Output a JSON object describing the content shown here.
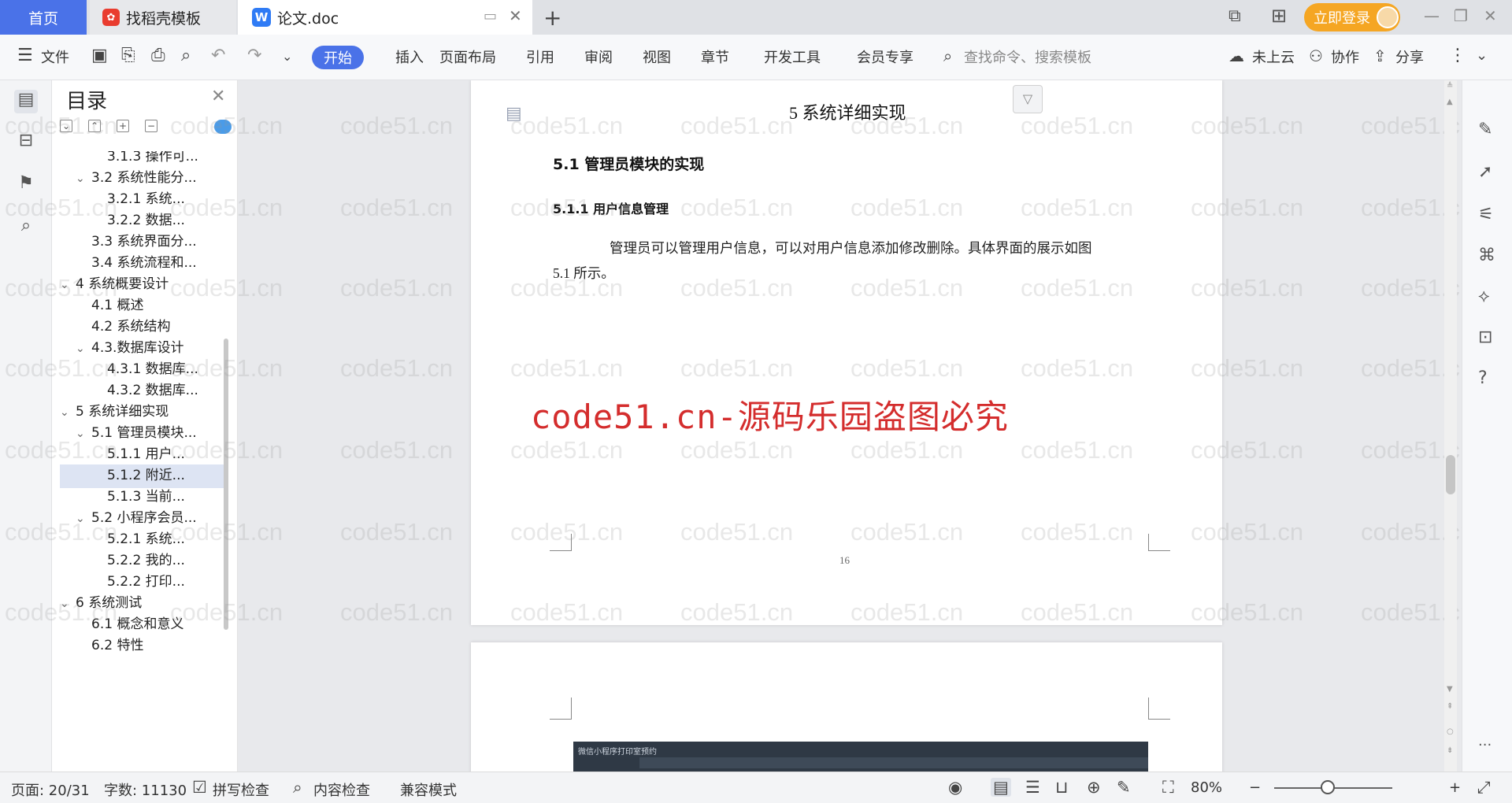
{
  "titlebar": {
    "tabs": [
      {
        "label": "首页"
      },
      {
        "label": "找稻壳模板"
      },
      {
        "label": "论文.doc"
      }
    ],
    "new_tab": "+",
    "login_button": "立即登录",
    "win_min": "—",
    "win_restore": "❐",
    "win_close": "✕"
  },
  "menubar": {
    "file": "文件",
    "items": [
      "开始",
      "插入",
      "页面布局",
      "引用",
      "审阅",
      "视图",
      "章节",
      "开发工具",
      "会员专享"
    ],
    "search_placeholder": "查找命令、搜索模板",
    "cloud": "未上云",
    "collab": "协作",
    "share": "分享"
  },
  "toc": {
    "title": "目录",
    "items": [
      {
        "label": "3.1.3 操作可...",
        "level": 3
      },
      {
        "label": "3.2 系统性能分...",
        "level": 2,
        "expanded": true
      },
      {
        "label": "3.2.1  系统...",
        "level": 3
      },
      {
        "label": "3.2.2  数据...",
        "level": 3
      },
      {
        "label": "3.3 系统界面分...",
        "level": 2
      },
      {
        "label": "3.4 系统流程和...",
        "level": 2
      },
      {
        "label": "4 系统概要设计",
        "level": 1,
        "expanded": true
      },
      {
        "label": "4.1 概述",
        "level": 2
      },
      {
        "label": "4.2 系统结构",
        "level": 2
      },
      {
        "label": "4.3.数据库设计",
        "level": 2,
        "expanded": true
      },
      {
        "label": "4.3.1 数据库...",
        "level": 3
      },
      {
        "label": "4.3.2 数据库...",
        "level": 3
      },
      {
        "label": "5 系统详细实现",
        "level": 1,
        "expanded": true,
        "selected": true
      },
      {
        "label": "5.1  管理员模块...",
        "level": 2,
        "expanded": true
      },
      {
        "label": "5.1.1  用户...",
        "level": 3
      },
      {
        "label": "5.1.2  附近...",
        "level": 3
      },
      {
        "label": "5.1.3  当前...",
        "level": 3
      },
      {
        "label": "5.2  小程序会员...",
        "level": 2,
        "expanded": true
      },
      {
        "label": "5.2.1  系统...",
        "level": 3
      },
      {
        "label": "5.2.2  我的...",
        "level": 3
      },
      {
        "label": "5.2.2  打印...",
        "level": 3
      },
      {
        "label": "6 系统测试",
        "level": 1,
        "expanded": true
      },
      {
        "label": "6.1 概念和意义",
        "level": 2
      },
      {
        "label": "6.2 特性",
        "level": 2
      }
    ]
  },
  "document": {
    "chapter_title": "5 系统详细实现",
    "section_title": "5.1  管理员模块的实现",
    "subsection_title": "5.1.1  用户信息管理",
    "paragraph_line1": "管理员可以管理用户信息，可以对用户信息添加修改删除。具体界面的展示如图",
    "paragraph_line2": "5.1 所示。",
    "page_number": "16",
    "red_watermark": "code51.cn-源码乐园盗图必究",
    "bg_watermark": "code51.cn",
    "preview_app_title": "微信小程序打印室预约"
  },
  "statusbar": {
    "page": "页面: 20/31",
    "words": "字数: 11130",
    "spellcheck": "拼写检查",
    "content_check": "内容检查",
    "compat": "兼容模式",
    "zoom": "80%",
    "zoom_level": 0.45
  },
  "colors": {
    "accent": "#4a72e8",
    "login": "#f5a623",
    "red_watermark": "#d42d2d"
  }
}
